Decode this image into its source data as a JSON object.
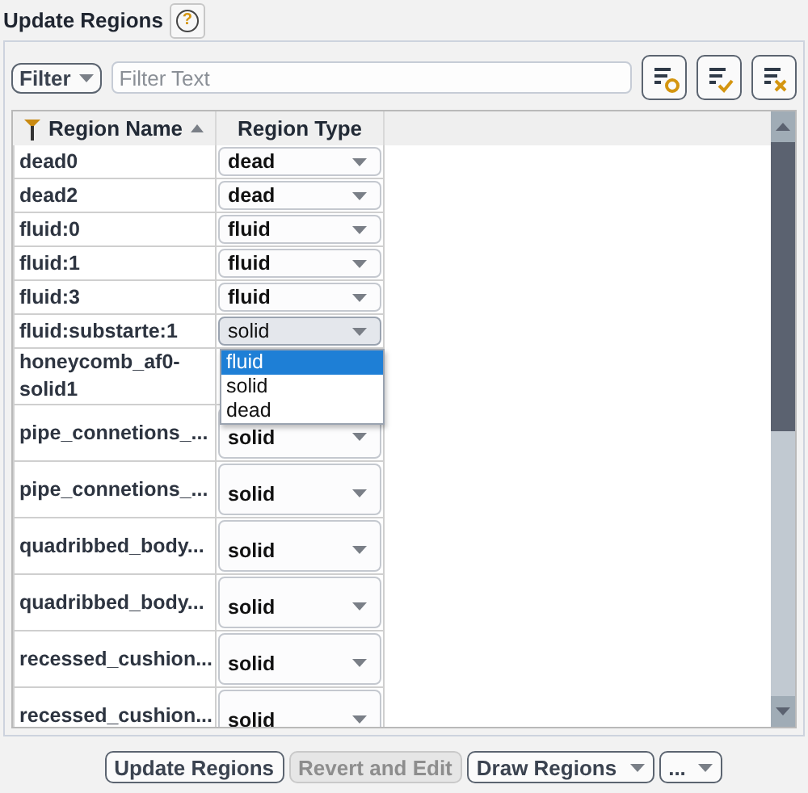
{
  "title": "Update Regions",
  "help_button": "?",
  "filter": {
    "menu": "Filter",
    "placeholder": "Filter Text"
  },
  "table": {
    "columns": [
      {
        "label": "Region Name",
        "sorted": true
      },
      {
        "label": "Region Type",
        "sorted": false
      }
    ],
    "rows": [
      {
        "name": "dead0",
        "type": "dead"
      },
      {
        "name": "dead2",
        "type": "dead"
      },
      {
        "name": "fluid:0",
        "type": "fluid"
      },
      {
        "name": "fluid:1",
        "type": "fluid"
      },
      {
        "name": "fluid:3",
        "type": "fluid"
      },
      {
        "name": "fluid:substarte:1",
        "type": "solid",
        "open": true,
        "options": [
          {
            "label": "fluid",
            "selected": true
          },
          {
            "label": "solid",
            "selected": false
          },
          {
            "label": "dead",
            "selected": false
          }
        ]
      },
      {
        "name": "honeycomb_af0-solid1"
      },
      {
        "name": "pipe_connetions_...",
        "type": "solid"
      },
      {
        "name": "pipe_connetions_...",
        "type": "solid"
      },
      {
        "name": "quadribbed_body...",
        "type": "solid"
      },
      {
        "name": "quadribbed_body...",
        "type": "solid"
      },
      {
        "name": "recessed_cushion...",
        "type": "solid"
      },
      {
        "name": "recessed_cushion...",
        "type": "solid"
      }
    ]
  },
  "buttons": [
    {
      "label": "Update Regions",
      "kind": "button",
      "disabled": false
    },
    {
      "label": "Revert and Edit",
      "kind": "button",
      "disabled": true
    },
    {
      "label": "Draw Regions",
      "kind": "dropdown",
      "disabled": false
    },
    {
      "label": "...",
      "kind": "dropdown",
      "disabled": false
    }
  ]
}
